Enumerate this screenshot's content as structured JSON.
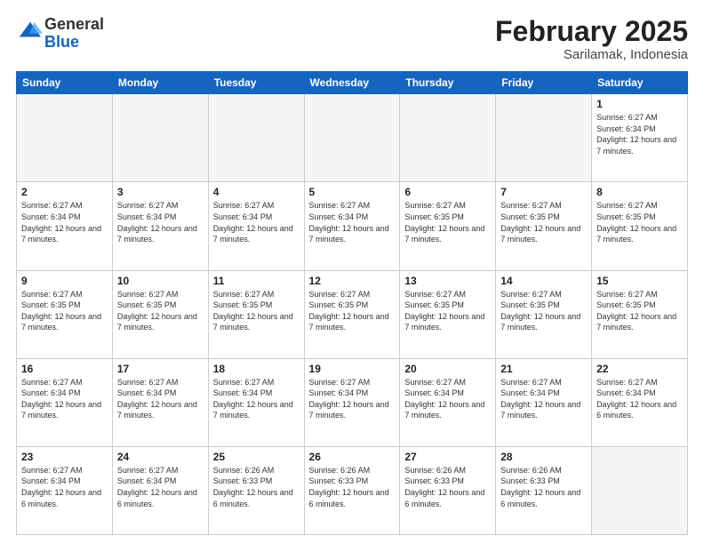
{
  "logo": {
    "general": "General",
    "blue": "Blue"
  },
  "title": "February 2025",
  "subtitle": "Sarilamak, Indonesia",
  "days_of_week": [
    "Sunday",
    "Monday",
    "Tuesday",
    "Wednesday",
    "Thursday",
    "Friday",
    "Saturday"
  ],
  "weeks": [
    [
      {
        "day": "",
        "info": ""
      },
      {
        "day": "",
        "info": ""
      },
      {
        "day": "",
        "info": ""
      },
      {
        "day": "",
        "info": ""
      },
      {
        "day": "",
        "info": ""
      },
      {
        "day": "",
        "info": ""
      },
      {
        "day": "1",
        "info": "Sunrise: 6:27 AM\nSunset: 6:34 PM\nDaylight: 12 hours and 7 minutes."
      }
    ],
    [
      {
        "day": "2",
        "info": "Sunrise: 6:27 AM\nSunset: 6:34 PM\nDaylight: 12 hours and 7 minutes."
      },
      {
        "day": "3",
        "info": "Sunrise: 6:27 AM\nSunset: 6:34 PM\nDaylight: 12 hours and 7 minutes."
      },
      {
        "day": "4",
        "info": "Sunrise: 6:27 AM\nSunset: 6:34 PM\nDaylight: 12 hours and 7 minutes."
      },
      {
        "day": "5",
        "info": "Sunrise: 6:27 AM\nSunset: 6:34 PM\nDaylight: 12 hours and 7 minutes."
      },
      {
        "day": "6",
        "info": "Sunrise: 6:27 AM\nSunset: 6:35 PM\nDaylight: 12 hours and 7 minutes."
      },
      {
        "day": "7",
        "info": "Sunrise: 6:27 AM\nSunset: 6:35 PM\nDaylight: 12 hours and 7 minutes."
      },
      {
        "day": "8",
        "info": "Sunrise: 6:27 AM\nSunset: 6:35 PM\nDaylight: 12 hours and 7 minutes."
      }
    ],
    [
      {
        "day": "9",
        "info": "Sunrise: 6:27 AM\nSunset: 6:35 PM\nDaylight: 12 hours and 7 minutes."
      },
      {
        "day": "10",
        "info": "Sunrise: 6:27 AM\nSunset: 6:35 PM\nDaylight: 12 hours and 7 minutes."
      },
      {
        "day": "11",
        "info": "Sunrise: 6:27 AM\nSunset: 6:35 PM\nDaylight: 12 hours and 7 minutes."
      },
      {
        "day": "12",
        "info": "Sunrise: 6:27 AM\nSunset: 6:35 PM\nDaylight: 12 hours and 7 minutes."
      },
      {
        "day": "13",
        "info": "Sunrise: 6:27 AM\nSunset: 6:35 PM\nDaylight: 12 hours and 7 minutes."
      },
      {
        "day": "14",
        "info": "Sunrise: 6:27 AM\nSunset: 6:35 PM\nDaylight: 12 hours and 7 minutes."
      },
      {
        "day": "15",
        "info": "Sunrise: 6:27 AM\nSunset: 6:35 PM\nDaylight: 12 hours and 7 minutes."
      }
    ],
    [
      {
        "day": "16",
        "info": "Sunrise: 6:27 AM\nSunset: 6:34 PM\nDaylight: 12 hours and 7 minutes."
      },
      {
        "day": "17",
        "info": "Sunrise: 6:27 AM\nSunset: 6:34 PM\nDaylight: 12 hours and 7 minutes."
      },
      {
        "day": "18",
        "info": "Sunrise: 6:27 AM\nSunset: 6:34 PM\nDaylight: 12 hours and 7 minutes."
      },
      {
        "day": "19",
        "info": "Sunrise: 6:27 AM\nSunset: 6:34 PM\nDaylight: 12 hours and 7 minutes."
      },
      {
        "day": "20",
        "info": "Sunrise: 6:27 AM\nSunset: 6:34 PM\nDaylight: 12 hours and 7 minutes."
      },
      {
        "day": "21",
        "info": "Sunrise: 6:27 AM\nSunset: 6:34 PM\nDaylight: 12 hours and 7 minutes."
      },
      {
        "day": "22",
        "info": "Sunrise: 6:27 AM\nSunset: 6:34 PM\nDaylight: 12 hours and 6 minutes."
      }
    ],
    [
      {
        "day": "23",
        "info": "Sunrise: 6:27 AM\nSunset: 6:34 PM\nDaylight: 12 hours and 6 minutes."
      },
      {
        "day": "24",
        "info": "Sunrise: 6:27 AM\nSunset: 6:34 PM\nDaylight: 12 hours and 6 minutes."
      },
      {
        "day": "25",
        "info": "Sunrise: 6:26 AM\nSunset: 6:33 PM\nDaylight: 12 hours and 6 minutes."
      },
      {
        "day": "26",
        "info": "Sunrise: 6:26 AM\nSunset: 6:33 PM\nDaylight: 12 hours and 6 minutes."
      },
      {
        "day": "27",
        "info": "Sunrise: 6:26 AM\nSunset: 6:33 PM\nDaylight: 12 hours and 6 minutes."
      },
      {
        "day": "28",
        "info": "Sunrise: 6:26 AM\nSunset: 6:33 PM\nDaylight: 12 hours and 6 minutes."
      },
      {
        "day": "",
        "info": ""
      }
    ]
  ]
}
